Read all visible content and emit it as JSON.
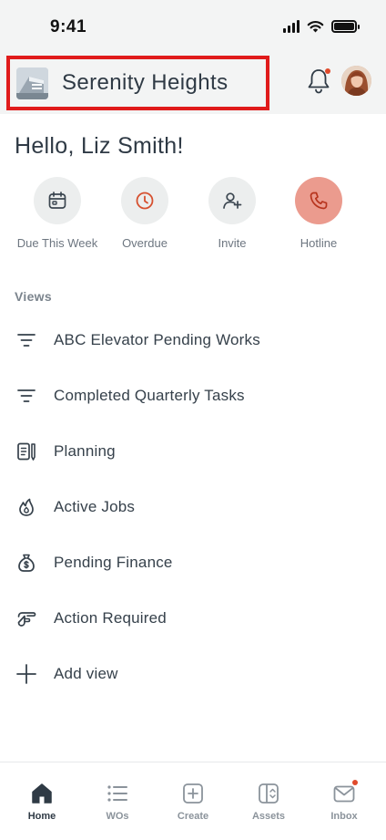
{
  "status_bar": {
    "time": "9:41"
  },
  "header": {
    "building_name": "Serenity Heights",
    "building_logo_icon": "building-photo",
    "notification_icon": "bell-icon",
    "has_notification": true
  },
  "greeting": "Hello, Liz Smith!",
  "quick_actions": [
    {
      "label": "Due This Week",
      "icon": "calendar-icon"
    },
    {
      "label": "Overdue",
      "icon": "clock-icon"
    },
    {
      "label": "Invite",
      "icon": "add-user-icon"
    },
    {
      "label": "Hotline",
      "icon": "phone-icon"
    }
  ],
  "views": {
    "heading": "Views",
    "items": [
      {
        "label": "ABC Elevator Pending Works",
        "icon": "filter-icon"
      },
      {
        "label": "Completed Quarterly Tasks",
        "icon": "filter-icon"
      },
      {
        "label": "Planning",
        "icon": "planning-icon"
      },
      {
        "label": "Active Jobs",
        "icon": "flame-icon"
      },
      {
        "label": "Pending Finance",
        "icon": "money-bag-icon"
      },
      {
        "label": "Action Required",
        "icon": "pointing-hand-icon"
      },
      {
        "label": "Add view",
        "icon": "plus-icon"
      }
    ]
  },
  "bottom_nav": [
    {
      "label": "Home",
      "icon": "home-icon",
      "active": true
    },
    {
      "label": "WOs",
      "icon": "list-icon",
      "active": false
    },
    {
      "label": "Create",
      "icon": "create-icon",
      "active": false
    },
    {
      "label": "Assets",
      "icon": "assets-icon",
      "active": false
    },
    {
      "label": "Inbox",
      "icon": "mail-icon",
      "active": false
    }
  ],
  "colors": {
    "accent": "#e04a2b",
    "hotline": "#eb9b8e",
    "highlight_box": "#e01b1b",
    "header_bg": "#f3f4f4"
  }
}
